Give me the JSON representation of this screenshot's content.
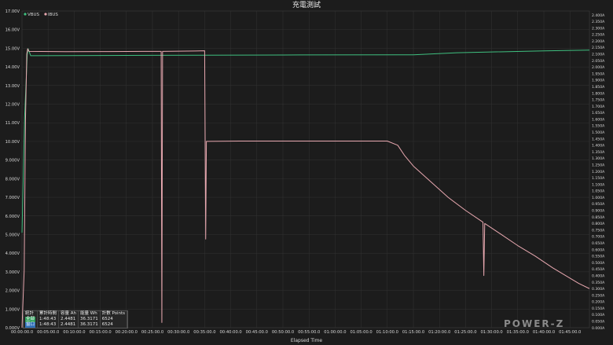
{
  "chart_data": {
    "type": "line",
    "title": "充電測試",
    "xlabel": "Elapsed Time",
    "x_unit": "seconds",
    "xlim": [
      0,
      6524
    ],
    "x_ticks": [
      0,
      300,
      600,
      900,
      1200,
      1500,
      1800,
      2100,
      2400,
      2700,
      3000,
      3300,
      3600,
      3900,
      4200,
      4500,
      4800,
      5100,
      5400,
      5700,
      6000,
      6300
    ],
    "x_tick_labels": [
      "00:00:00.0",
      "00:05:00.0",
      "00:10:00.0",
      "00:15:00.0",
      "00:20:00.0",
      "00:25:00.0",
      "00:30:00.0",
      "00:35:00.0",
      "00:40:00.0",
      "00:45:00.0",
      "00:50:00.0",
      "00:55:00.0",
      "01:00:00.0",
      "01:05:00.0",
      "01:10:00.0",
      "01:15:00.0",
      "01:20:00.0",
      "01:25:00.0",
      "01:30:00.0",
      "01:35:00.0",
      "01:40:00.0",
      "01:45:00.0"
    ],
    "y_left": {
      "unit": "V",
      "lim": [
        0,
        17
      ],
      "ticks": [
        0,
        1,
        2,
        3,
        4,
        5,
        6,
        7,
        8,
        9,
        10,
        11,
        12,
        13,
        14,
        15,
        16,
        17
      ],
      "tick_labels": [
        "0.000V",
        "1.000V",
        "2.000V",
        "3.000V",
        "4.000V",
        "5.000V",
        "6.000V",
        "7.000V",
        "8.000V",
        "9.000V",
        "10.00V",
        "11.00V",
        "12.00V",
        "13.00V",
        "14.00V",
        "15.00V",
        "16.00V",
        "17.00V"
      ]
    },
    "y_right": {
      "unit": "A",
      "lim": [
        0,
        2.43
      ],
      "ticks": [
        0.0,
        0.05,
        0.1,
        0.15,
        0.2,
        0.25,
        0.3,
        0.35,
        0.4,
        0.45,
        0.5,
        0.55,
        0.6,
        0.65,
        0.7,
        0.75,
        0.8,
        0.85,
        0.9,
        0.95,
        1.0,
        1.05,
        1.1,
        1.15,
        1.2,
        1.25,
        1.3,
        1.35,
        1.4,
        1.45,
        1.5,
        1.55,
        1.6,
        1.65,
        1.7,
        1.75,
        1.8,
        1.85,
        1.9,
        1.95,
        2.0,
        2.05,
        2.1,
        2.15,
        2.2,
        2.25,
        2.3,
        2.35,
        2.4
      ],
      "tick_labels": [
        "0.000A",
        "0.050A",
        "0.100A",
        "0.150A",
        "0.200A",
        "0.250A",
        "0.300A",
        "0.350A",
        "0.400A",
        "0.450A",
        "0.500A",
        "0.550A",
        "0.600A",
        "0.650A",
        "0.700A",
        "0.750A",
        "0.800A",
        "0.850A",
        "0.900A",
        "0.950A",
        "1.000A",
        "1.050A",
        "1.100A",
        "1.150A",
        "1.200A",
        "1.250A",
        "1.300A",
        "1.350A",
        "1.400A",
        "1.450A",
        "1.500A",
        "1.550A",
        "1.600A",
        "1.650A",
        "1.700A",
        "1.750A",
        "1.800A",
        "1.850A",
        "1.900A",
        "1.950A",
        "2.000A",
        "2.050A",
        "2.100A",
        "2.150A",
        "2.200A",
        "2.250A",
        "2.300A",
        "2.350A",
        "2.400A"
      ]
    },
    "grid": true,
    "legend_position": "top-left",
    "series": [
      {
        "name": "VBUS",
        "axis": "left",
        "color": "#3fbf7f",
        "points": [
          [
            0,
            5.1
          ],
          [
            30,
            11.3
          ],
          [
            60,
            14.65
          ],
          [
            70,
            14.98
          ],
          [
            100,
            14.6
          ],
          [
            1500,
            14.62
          ],
          [
            3000,
            14.64
          ],
          [
            4500,
            14.65
          ],
          [
            5000,
            14.76
          ],
          [
            6000,
            14.86
          ],
          [
            6524,
            14.9
          ]
        ]
      },
      {
        "name": "IBUS",
        "axis": "right",
        "color": "#e8a8b0",
        "points": [
          [
            0,
            0.0
          ],
          [
            25,
            0.44
          ],
          [
            40,
            1.6
          ],
          [
            55,
            2.1
          ],
          [
            65,
            2.14
          ],
          [
            80,
            2.12
          ],
          [
            500,
            2.118
          ],
          [
            1000,
            2.119
          ],
          [
            1400,
            2.12
          ],
          [
            1600,
            2.12
          ],
          [
            1608,
            0.04
          ],
          [
            1616,
            2.12
          ],
          [
            2000,
            2.123
          ],
          [
            2100,
            2.125
          ],
          [
            2112,
            0.68
          ],
          [
            2120,
            1.43
          ],
          [
            2500,
            1.432
          ],
          [
            3000,
            1.432
          ],
          [
            3500,
            1.432
          ],
          [
            4200,
            1.432
          ],
          [
            4320,
            1.4
          ],
          [
            4400,
            1.32
          ],
          [
            4500,
            1.24
          ],
          [
            4700,
            1.12
          ],
          [
            4900,
            1.0
          ],
          [
            5100,
            0.9
          ],
          [
            5300,
            0.81
          ],
          [
            5310,
            0.4
          ],
          [
            5320,
            0.8
          ],
          [
            5500,
            0.72
          ],
          [
            5700,
            0.63
          ],
          [
            5900,
            0.55
          ],
          [
            6100,
            0.46
          ],
          [
            6300,
            0.38
          ],
          [
            6400,
            0.34
          ],
          [
            6524,
            0.3
          ]
        ]
      }
    ]
  },
  "stats": {
    "header": [
      "統計",
      "累計時間",
      "容量 Ah",
      "能量 Wh",
      "計數 Points"
    ],
    "rows": [
      {
        "label": "全部",
        "time": "1:48:43",
        "ah": "2.4481",
        "wh": "36.3171",
        "points": "6524",
        "color": "#2e9e5a"
      },
      {
        "label": "窗口",
        "time": "1:48:43",
        "ah": "2.4481",
        "wh": "36.3171",
        "points": "6524",
        "color": "#2f6fb8"
      }
    ]
  },
  "watermark": "POWER-Z",
  "colors": {
    "background": "#1c1c1c",
    "plot_background": "#1c1c1c",
    "grid": "#333333",
    "axis_text": "#d8d8d8",
    "vbus": "#3fbf7f",
    "ibus": "#e8a8b0"
  }
}
